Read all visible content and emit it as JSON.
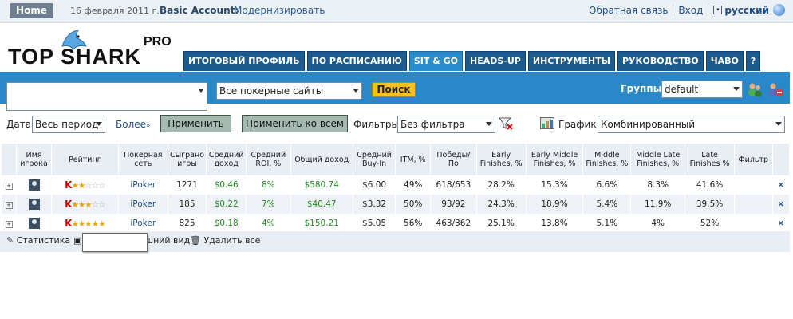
{
  "topbar": {
    "home": "Home",
    "date": "16 февраля 2011 г.",
    "account": "Basic Account:",
    "upgrade": "Модернизировать",
    "feedback": "Обратная связь",
    "login": "Вход",
    "language": "русский"
  },
  "logo": {
    "name": "TOP SHARK",
    "pro": "PRO"
  },
  "tabs": [
    {
      "label": "ИТОГОВЫЙ ПРОФИЛЬ",
      "active": false
    },
    {
      "label": "ПО РАСПИСАНИЮ",
      "active": false
    },
    {
      "label": "SIT & GO",
      "active": true
    },
    {
      "label": "HEADS-UP",
      "active": false
    },
    {
      "label": "ИНСТРУМЕНТЫ",
      "active": false
    },
    {
      "label": "РУКОВОДСТВО",
      "active": false
    },
    {
      "label": "ЧАВО",
      "active": false
    },
    {
      "label": "?",
      "active": false
    }
  ],
  "search": {
    "player_value": "",
    "sites_value": "Все покерные сайты",
    "button": "Поиск",
    "groups_label": "Группы:",
    "groups_value": "default"
  },
  "filters": {
    "date_label": "Дата:",
    "date_value": "Весь период",
    "more": "Более",
    "apply": "Применить",
    "apply_all": "Применить ко всем",
    "filters_label": "Фильтры:",
    "filters_value": "Без фильтра",
    "chart_label": "График:",
    "chart_value": "Комбинированный"
  },
  "table": {
    "headers": [
      "",
      "Имя игрока",
      "Рейтинг",
      "Покерная сеть",
      "Сыграно игры",
      "Средний доход",
      "Средний ROI, %",
      "Общий доход",
      "Средний Buy-In",
      "ITM, %",
      "Победы/По",
      "Early Finishes, %",
      "Early Middle Finishes, %",
      "Middle Finishes, %",
      "Middle Late Finishes, %",
      "Late Finishes %",
      "Фильтр",
      ""
    ],
    "rows": [
      {
        "rating_stars": 2,
        "site": "iPoker",
        "games": "1271",
        "avg_profit": "$0.46",
        "roi": "8%",
        "total": "$580.74",
        "buyin": "$6.00",
        "itm": "49%",
        "wins": "618/653",
        "early": "28.2%",
        "early_mid": "15.3%",
        "mid": "6.6%",
        "mid_late": "8.3%",
        "late": "41.6%"
      },
      {
        "rating_stars": 3,
        "site": "iPoker",
        "games": "185",
        "avg_profit": "$0.22",
        "roi": "7%",
        "total": "$40.47",
        "buyin": "$3.32",
        "itm": "50%",
        "wins": "93/92",
        "early": "24.3%",
        "early_mid": "18.9%",
        "mid": "5.4%",
        "mid_late": "11.9%",
        "late": "39.5%"
      },
      {
        "rating_stars": 5,
        "site": "iPoker",
        "games": "825",
        "avg_profit": "$0.18",
        "roi": "4%",
        "total": "$150.21",
        "buyin": "$5.05",
        "itm": "56%",
        "wins": "463/362",
        "early": "25.1%",
        "early_mid": "13.8%",
        "mid": "5.1%",
        "mid_late": "4%",
        "late": "52%"
      }
    ],
    "rating_letter": "K",
    "delete_glyph": "×"
  },
  "bottom": {
    "stats": "Статистика",
    "view": "шний вид",
    "delete_all": "Удалить все"
  }
}
